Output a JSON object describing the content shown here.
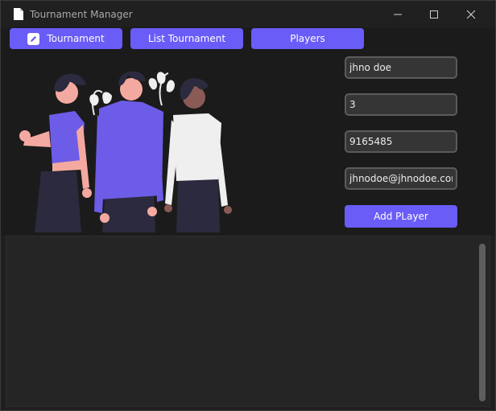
{
  "window": {
    "title": "Tournament Manager",
    "icon": "document-icon",
    "controls": [
      "minimize-icon",
      "maximize-icon",
      "close-icon"
    ]
  },
  "nav": {
    "tournament_label": "Tournament",
    "list_label": "List Tournament",
    "players_label": "Players",
    "tournament_icon": "pencil-icon"
  },
  "form": {
    "name": "jhno doe",
    "number": "3",
    "phone": "9165485",
    "email": "jhnodoe@jhnodoe.com",
    "submit_label": "Add PLayer"
  },
  "colors": {
    "accent": "#6a5cf6",
    "background": "#1b1b1b",
    "field": "#353535",
    "list": "#252525"
  }
}
